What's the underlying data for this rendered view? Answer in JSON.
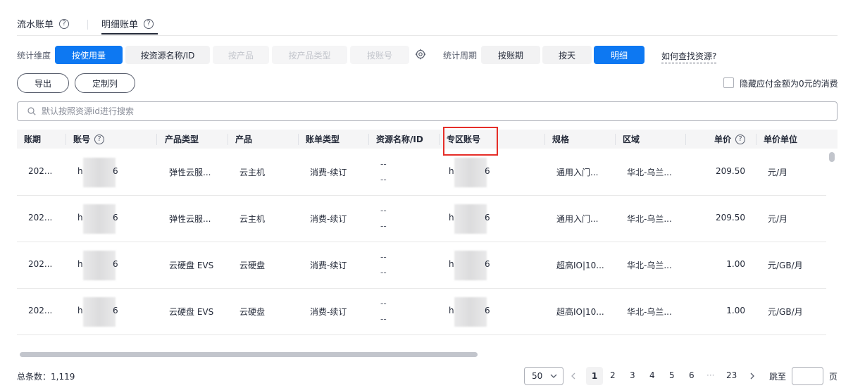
{
  "tabs": [
    {
      "label": "流水账单",
      "active": false
    },
    {
      "label": "明细账单",
      "active": true
    }
  ],
  "filters": {
    "dimension_label": "统计维度",
    "dimension_options": [
      {
        "label": "按使用量",
        "state": "active"
      },
      {
        "label": "按资源名称/ID",
        "state": "normal"
      },
      {
        "label": "按产品",
        "state": "disabled"
      },
      {
        "label": "按产品类型",
        "state": "disabled"
      },
      {
        "label": "按账号",
        "state": "disabled"
      }
    ],
    "period_label": "统计周期",
    "period_options": [
      {
        "label": "按账期",
        "state": "normal"
      },
      {
        "label": "按天",
        "state": "normal"
      },
      {
        "label": "明细",
        "state": "active"
      }
    ],
    "help_link": "如何查找资源?"
  },
  "actions": {
    "export_label": "导出",
    "customize_label": "定制列",
    "hide_zero_label": "隐藏应付金额为0元的消费"
  },
  "search": {
    "placeholder": "默认按照资源id进行搜索",
    "value": ""
  },
  "table": {
    "columns": [
      "账期",
      "账号",
      "产品类型",
      "产品",
      "账单类型",
      "资源名称/ID",
      "专区账号",
      "规格",
      "区域",
      "单价",
      "单价单位"
    ],
    "rows": [
      {
        "period": "202...",
        "account": "h",
        "account_tail": "6",
        "product_type": "弹性云服...",
        "product": "云主机",
        "bill_type": "消费-续订",
        "res_line1": "--",
        "res_line2": "--",
        "zone_account": "h",
        "zone_tail": "6",
        "spec": "通用入门...",
        "region": "华北-乌兰...",
        "price": "209.50",
        "unit": "元/月"
      },
      {
        "period": "202...",
        "account": "h",
        "account_tail": "6",
        "product_type": "弹性云服...",
        "product": "云主机",
        "bill_type": "消费-续订",
        "res_line1": "--",
        "res_line2": "--",
        "zone_account": "h",
        "zone_tail": "6",
        "spec": "通用入门...",
        "region": "华北-乌兰...",
        "price": "209.50",
        "unit": "元/月"
      },
      {
        "period": "202...",
        "account": "h",
        "account_tail": "6",
        "product_type": "云硬盘 EVS",
        "product": "云硬盘",
        "bill_type": "消费-续订",
        "res_line1": "--",
        "res_line2": "--",
        "zone_account": "h",
        "zone_tail": "6",
        "spec": "超高IO|10...",
        "region": "华北-乌兰...",
        "price": "1.00",
        "unit": "元/GB/月"
      },
      {
        "period": "202...",
        "account": "h",
        "account_tail": "6",
        "product_type": "云硬盘 EVS",
        "product": "云硬盘",
        "bill_type": "消费-续订",
        "res_line1": "--",
        "res_line2": "--",
        "zone_account": "h",
        "zone_tail": "6",
        "spec": "超高IO|10...",
        "region": "华北-乌兰...",
        "price": "1.00",
        "unit": "元/GB/月"
      }
    ]
  },
  "footer": {
    "total_label": "总条数：1,119",
    "page_size": "50",
    "pages": [
      "1",
      "2",
      "3",
      "4",
      "5",
      "6",
      "···",
      "23"
    ],
    "current_page": "1",
    "jump_label": "跳至",
    "page_suffix": "页"
  },
  "colors": {
    "accent": "#0d78f2",
    "highlight": "#e52e28"
  }
}
